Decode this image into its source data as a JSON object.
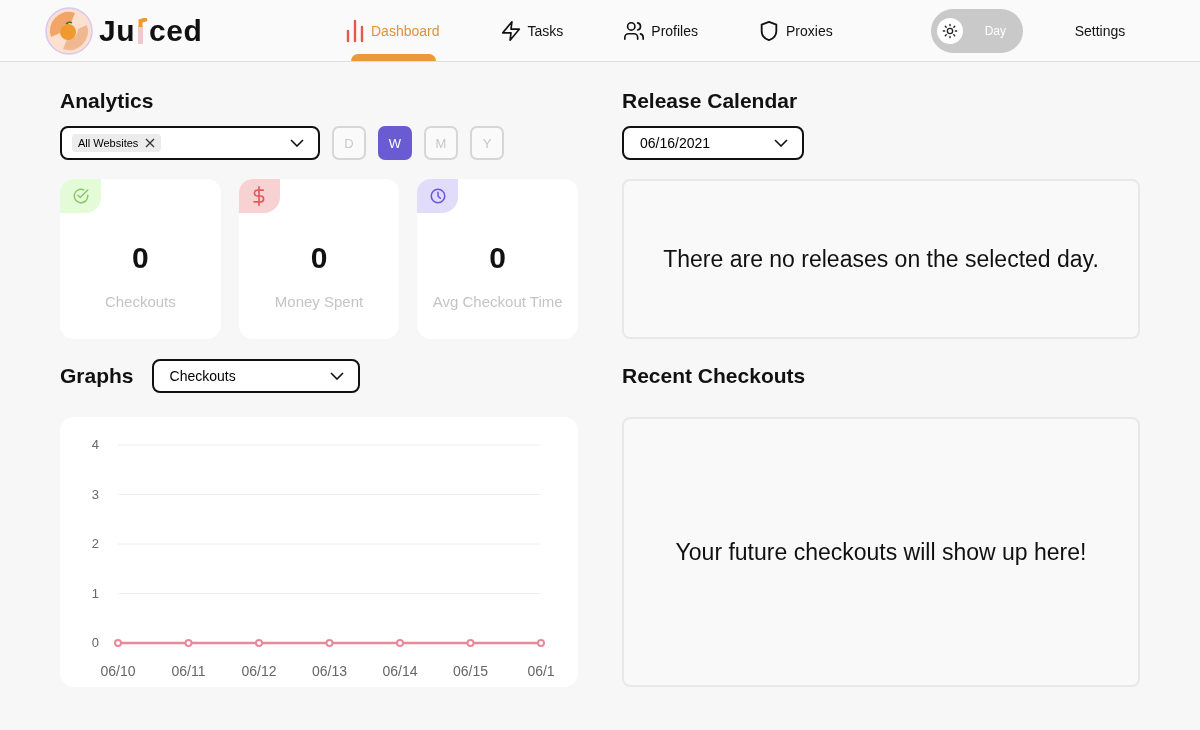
{
  "brand": {
    "start": "Ju",
    "end": "ced"
  },
  "nav": [
    {
      "label": "Dashboard",
      "kind": "bars",
      "selected": true
    },
    {
      "label": "Tasks",
      "kind": "bolt",
      "selected": false
    },
    {
      "label": "Profiles",
      "kind": "users",
      "selected": false
    },
    {
      "label": "Proxies",
      "kind": "shield",
      "selected": false
    }
  ],
  "theme_toggle": {
    "label": "Day"
  },
  "settings": "Settings",
  "analytics": {
    "title": "Analytics",
    "filter_tag": "All Websites",
    "periods": [
      {
        "label": "D",
        "selected": false
      },
      {
        "label": "W",
        "selected": true
      },
      {
        "label": "M",
        "selected": false
      },
      {
        "label": "Y",
        "selected": false
      }
    ],
    "stats": [
      {
        "kind": "check",
        "value": "0",
        "label": "Checkouts",
        "color": "#e3fbd6"
      },
      {
        "kind": "dollar",
        "value": "0",
        "label": "Money Spent",
        "color": "#f8d2d2"
      },
      {
        "kind": "clock",
        "value": "0",
        "label": "Avg Checkout Time",
        "color": "#e2dcfb"
      }
    ]
  },
  "graphs": {
    "title": "Graphs",
    "select": "Checkouts",
    "chart_data": {
      "type": "line",
      "categories": [
        "06/10",
        "06/11",
        "06/12",
        "06/13",
        "06/14",
        "06/15",
        "06/1"
      ],
      "series": [
        {
          "color": "#e8899b",
          "marker": "circle",
          "values": [
            0,
            0,
            0,
            0,
            0,
            0,
            0
          ]
        }
      ],
      "ylim": [
        0,
        4
      ],
      "yticks": [
        0,
        1,
        2,
        3,
        4
      ],
      "grid": true
    }
  },
  "release_calendar": {
    "title": "Release Calendar",
    "date": "06/16/2021",
    "message": "There are no releases on the selected day."
  },
  "recent_checkouts": {
    "title": "Recent Checkouts",
    "message": "Your future checkouts will show up here!"
  }
}
